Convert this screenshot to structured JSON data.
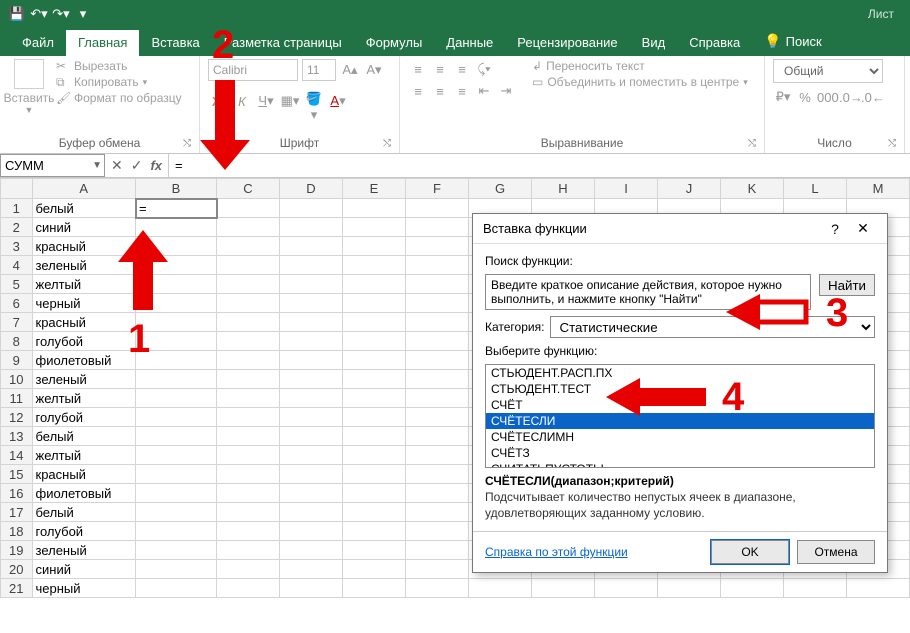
{
  "titlebar": {
    "doc": "Лист"
  },
  "tabs": {
    "file": "Файл",
    "home": "Главная",
    "insert": "Вставка",
    "layout": "Разметка страницы",
    "formulas": "Формулы",
    "data": "Данные",
    "review": "Рецензирование",
    "view": "Вид",
    "help": "Справка",
    "tellme": "Поиск"
  },
  "ribbon": {
    "clipboard": {
      "paste": "Вставить",
      "cut": "Вырезать",
      "copy": "Копировать",
      "fp": "Формат по образцу",
      "label": "Буфер обмена"
    },
    "font": {
      "name": "Calibri",
      "size": "11",
      "label": "Шрифт"
    },
    "align": {
      "wrap": "Переносить текст",
      "merge": "Объединить и поместить в центре",
      "label": "Выравнивание"
    },
    "number": {
      "format": "Общий",
      "label": "Число"
    }
  },
  "namebox": "СУММ",
  "formula": "=",
  "columns": [
    "A",
    "B",
    "C",
    "D",
    "E",
    "F",
    "G",
    "H",
    "I",
    "J",
    "K",
    "L",
    "M"
  ],
  "rows": [
    {
      "n": 1,
      "a": "белый",
      "b": "="
    },
    {
      "n": 2,
      "a": "синий"
    },
    {
      "n": 3,
      "a": "красный"
    },
    {
      "n": 4,
      "a": "зеленый"
    },
    {
      "n": 5,
      "a": "желтый"
    },
    {
      "n": 6,
      "a": "черный"
    },
    {
      "n": 7,
      "a": "красный"
    },
    {
      "n": 8,
      "a": "голубой"
    },
    {
      "n": 9,
      "a": "фиолетовый"
    },
    {
      "n": 10,
      "a": "зеленый"
    },
    {
      "n": 11,
      "a": "желтый"
    },
    {
      "n": 12,
      "a": "голубой"
    },
    {
      "n": 13,
      "a": "белый"
    },
    {
      "n": 14,
      "a": "желтый"
    },
    {
      "n": 15,
      "a": "красный"
    },
    {
      "n": 16,
      "a": "фиолетовый"
    },
    {
      "n": 17,
      "a": "белый"
    },
    {
      "n": 18,
      "a": "голубой"
    },
    {
      "n": 19,
      "a": "зеленый"
    },
    {
      "n": 20,
      "a": "синий"
    },
    {
      "n": 21,
      "a": "черный"
    }
  ],
  "dialog": {
    "title": "Вставка функции",
    "search_label": "Поиск функции:",
    "search_placeholder": "Введите краткое описание действия, которое нужно выполнить, и нажмите кнопку \"Найти\"",
    "go": "Найти",
    "cat_label": "Категория:",
    "cat_value": "Статистические",
    "select_label": "Выберите функцию:",
    "functions": [
      "СТЬЮДЕНТ.РАСП.ПХ",
      "СТЬЮДЕНТ.ТЕСТ",
      "СЧЁТ",
      "СЧЁТЕСЛИ",
      "СЧЁТЕСЛИМН",
      "СЧЁТЗ",
      "СЧИТАТЬПУСТОТЫ"
    ],
    "selected_index": 3,
    "sig": "СЧЁТЕСЛИ(диапазон;критерий)",
    "desc": "Подсчитывает количество непустых ячеек в диапазоне, удовлетворяющих заданному условию.",
    "help": "Справка по этой функции",
    "ok": "OK",
    "cancel": "Отмена"
  },
  "anno": {
    "n1": "1",
    "n2": "2",
    "n3": "3",
    "n4": "4"
  }
}
